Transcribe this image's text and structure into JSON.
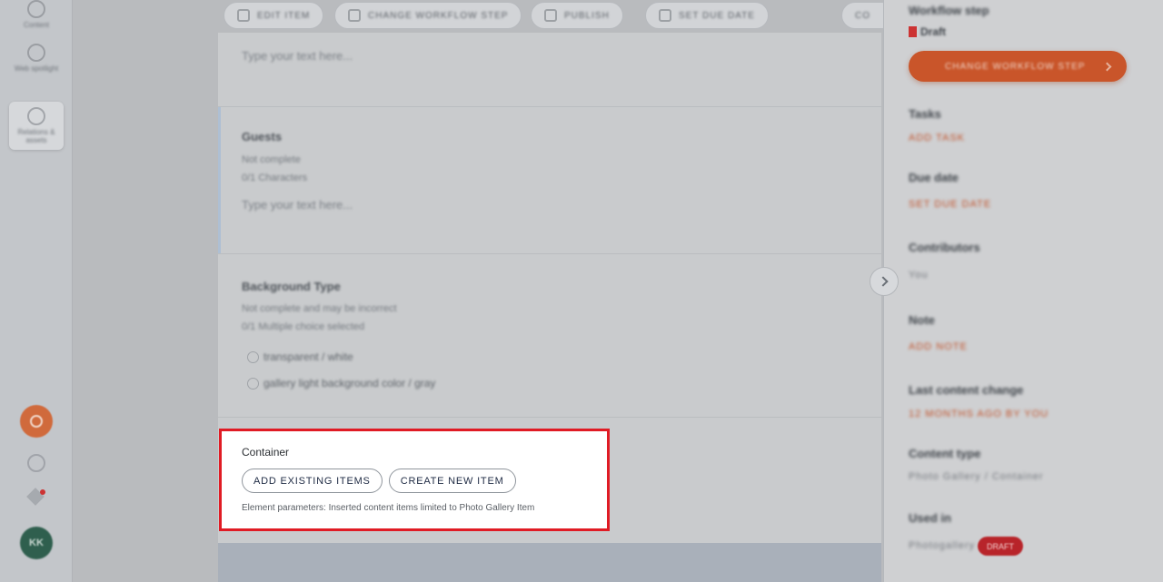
{
  "rail": {
    "items": [
      {
        "label": "Content"
      },
      {
        "label": "Web spotlight"
      },
      {
        "label": "Relations & assets"
      }
    ],
    "avatar_initials": "KK"
  },
  "topbar": {
    "pills": [
      {
        "label": "EDIT ITEM"
      },
      {
        "label": "CHANGE WORKFLOW STEP"
      },
      {
        "label": "PUBLISH"
      },
      {
        "label": "SET DUE DATE"
      },
      {
        "label": "CO"
      }
    ]
  },
  "main": {
    "sections": [
      {
        "placeholder": "Type your text here..."
      },
      {
        "title": "Guests",
        "lines": [
          "Not complete",
          "0/1 Characters"
        ],
        "placeholder": "Type your text here..."
      },
      {
        "title": "Background Type",
        "lines": [
          "Not complete and may be incorrect",
          "0/1 Multiple choice selected"
        ],
        "options": [
          "transparent / white",
          "gallery light background color / gray"
        ]
      }
    ],
    "container": {
      "label": "Container",
      "add_existing_label": "ADD EXISTING ITEMS",
      "create_new_label": "CREATE NEW ITEM",
      "params_text": "Element parameters: Inserted content items limited to Photo Gallery Item"
    }
  },
  "sidebar": {
    "workflow_title": "Workflow step",
    "workflow_value": "Draft",
    "workflow_button": "CHANGE WORKFLOW STEP",
    "fields": [
      {
        "title": "Tasks",
        "value": "ADD TASK",
        "tone": "orange"
      },
      {
        "title": "Due date",
        "value": "SET DUE DATE",
        "tone": "orange"
      },
      {
        "title": "Contributors",
        "value": "You",
        "tone": "gray"
      },
      {
        "title": "Note",
        "value": "ADD NOTE",
        "tone": "orange"
      },
      {
        "title": "Last content change",
        "value": "12 MONTHS AGO BY YOU",
        "tone": "orange"
      },
      {
        "title": "Content type",
        "value": "Photo Gallery / Container",
        "tone": "gray"
      },
      {
        "title": "Used in",
        "value": "Photogallery",
        "tone": "gray"
      }
    ],
    "used_in_badge": "DRAFT"
  },
  "colors": {
    "highlight_border": "#e01b24",
    "accent_orange": "#c9552a",
    "button_text": "#1f2b44"
  }
}
